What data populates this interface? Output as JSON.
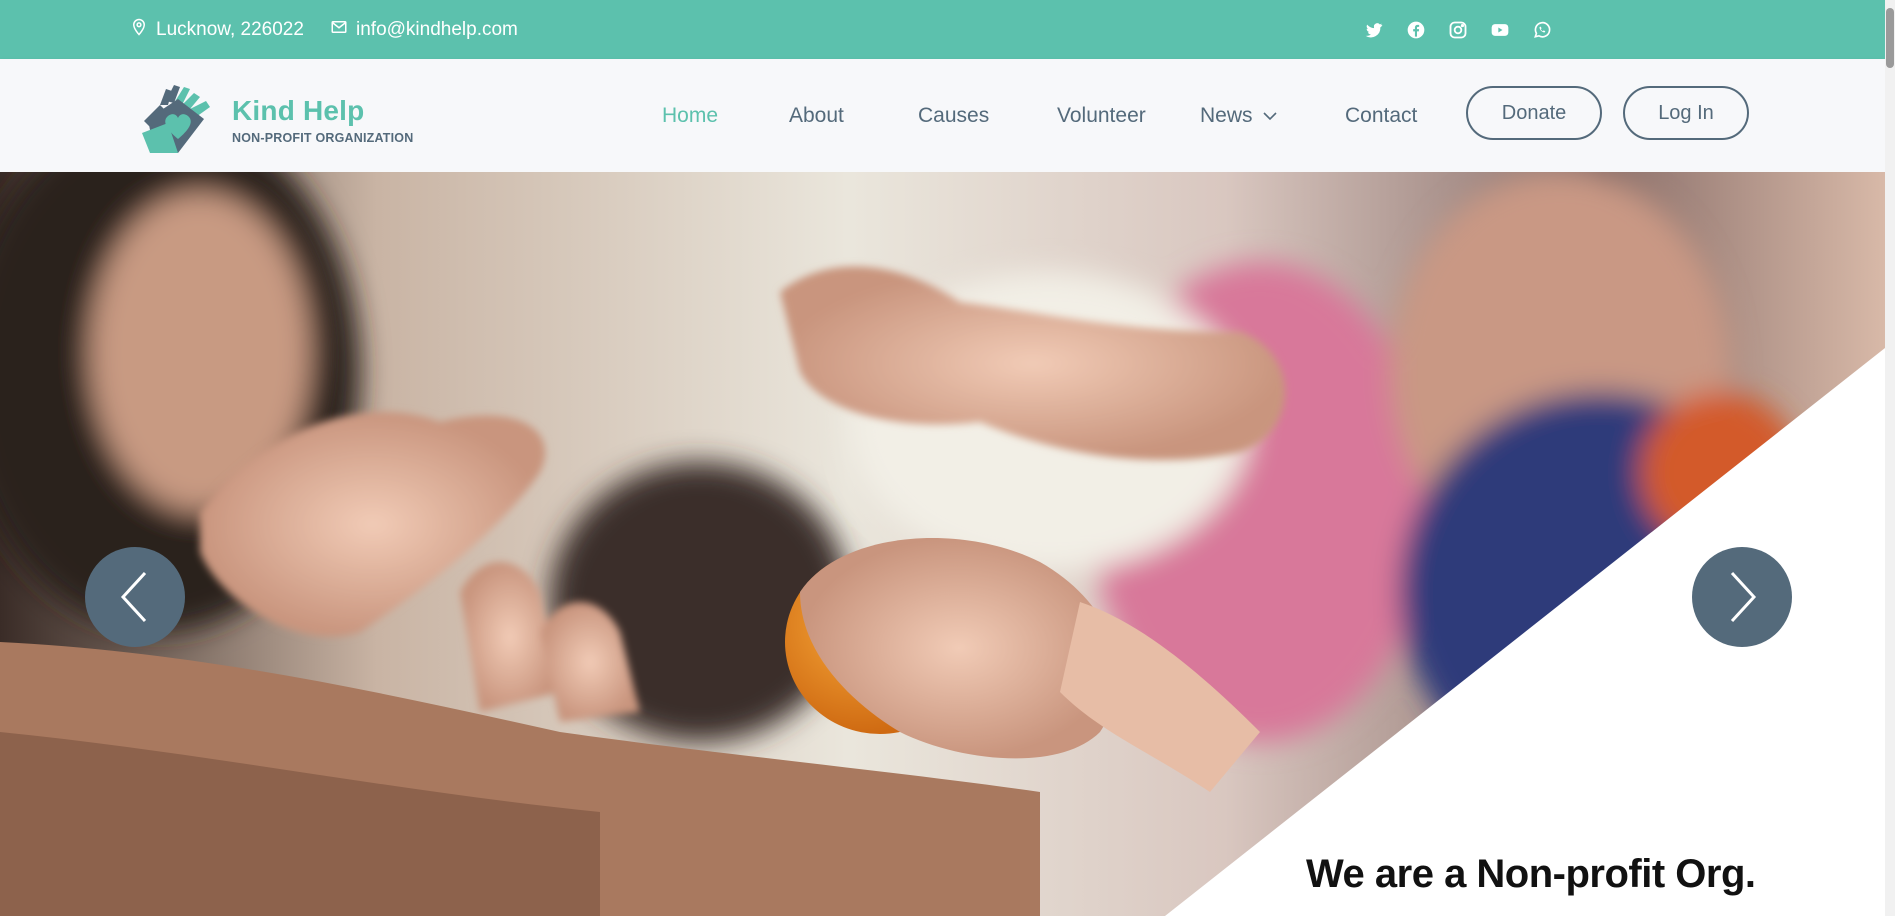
{
  "topbar": {
    "location": "Lucknow, 226022",
    "email": "info@kindhelp.com",
    "location_icon": "map-pin-icon",
    "email_icon": "envelope-icon",
    "socials": [
      "twitter-icon",
      "facebook-icon",
      "instagram-icon",
      "youtube-icon",
      "whatsapp-icon"
    ]
  },
  "header": {
    "brand_name": "Kind Help",
    "brand_tagline": "NON-PROFIT ORGANIZATION",
    "nav": {
      "home": "Home",
      "about": "About",
      "causes": "Causes",
      "volunteer": "Volunteer",
      "news": "News",
      "contact": "Contact"
    },
    "donate_label": "Donate",
    "login_label": "Log In"
  },
  "hero": {
    "title": "We are a Non-profit Org.",
    "prev_icon": "chevron-left-icon",
    "next_icon": "chevron-right-icon"
  },
  "colors": {
    "accent": "#5cc1ad",
    "slate": "#546a7b",
    "header_bg": "#f7f8fa"
  }
}
